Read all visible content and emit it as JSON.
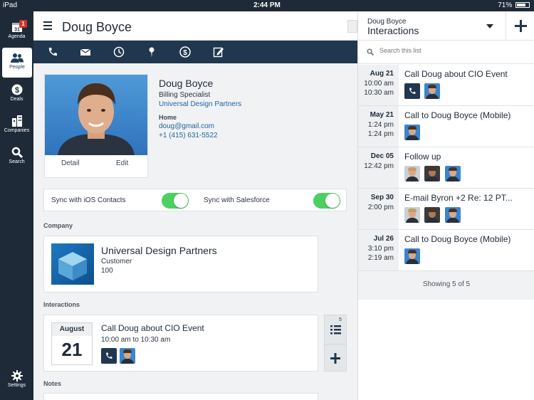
{
  "status": {
    "carrier": "iPad",
    "time": "2:44 PM",
    "battery": "71%"
  },
  "rail": {
    "items": [
      {
        "label": "Agenda",
        "badge": "1"
      },
      {
        "label": "People"
      },
      {
        "label": "Deals"
      },
      {
        "label": "Companies"
      },
      {
        "label": "Search"
      }
    ],
    "settings": "Settings",
    "calendar_day": "31"
  },
  "header": {
    "title": "Doug Boyce"
  },
  "contact": {
    "name": "Doug Boyce",
    "role": "Billing Specialist",
    "company": "Universal Design Partners",
    "home_label": "Home",
    "email": "doug@gmail.com",
    "phone": "+1 (415) 631-5522",
    "detail_button": "Detail",
    "edit_button": "Edit"
  },
  "sync": {
    "ios_label": "Sync with iOS Contacts",
    "ios_on": true,
    "sf_label": "Sync with Salesforce",
    "sf_on": true
  },
  "company_section": {
    "heading": "Company",
    "name": "Universal Design Partners",
    "type": "Customer",
    "number": "100"
  },
  "interactions_section": {
    "heading": "Interactions",
    "month": "August",
    "day": "21",
    "title": "Call Doug about CIO Event",
    "time": "10:00 am to 10:30 am",
    "list_count": "5"
  },
  "notes_section": {
    "heading": "Notes"
  },
  "panel": {
    "subtitle": "Doug Boyce",
    "title": "Interactions",
    "search_placeholder": "Search this list",
    "rows": [
      {
        "date": "Aug 21",
        "times": [
          "10:00 am",
          "10:30 am"
        ],
        "title": "Call Doug about CIO Event"
      },
      {
        "date": "May 21",
        "times": [
          "1:24 pm",
          "1:24 pm"
        ],
        "title": "Call to Doug Boyce (Mobile)"
      },
      {
        "date": "Dec 05",
        "times": [
          "12:42 pm"
        ],
        "title": "Follow up"
      },
      {
        "date": "Sep 30",
        "times": [
          "2:00 pm"
        ],
        "title": "E-mail Byron +2 Re: 12 PT..."
      },
      {
        "date": "Jul 26",
        "times": [
          "3:10 pm",
          "2:19 am"
        ],
        "title": "Call to Doug Boyce (Mobile)"
      }
    ],
    "footer": "Showing 5 of 5"
  },
  "colors": {
    "nav": "#1e2a38",
    "toolbar": "#20374f",
    "link": "#1d63a6",
    "toggle_on": "#4cd160"
  }
}
